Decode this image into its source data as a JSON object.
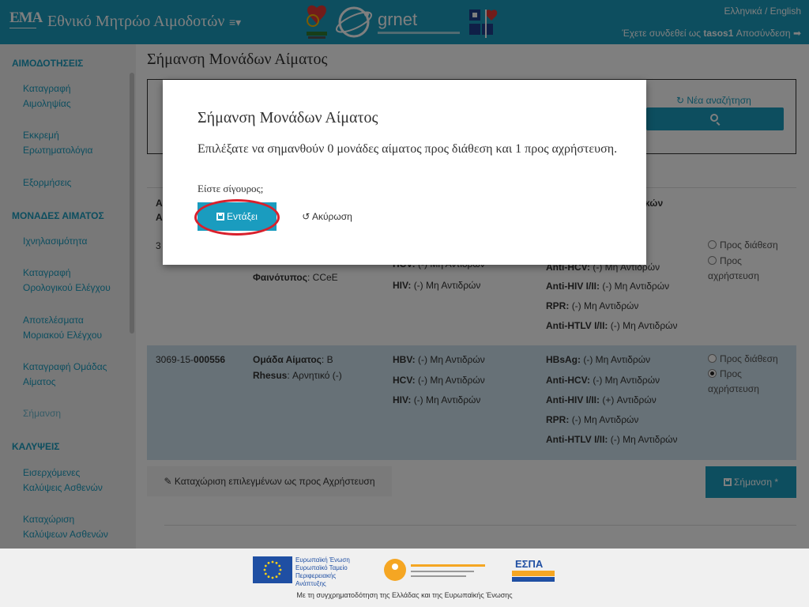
{
  "header": {
    "logo": "ΕΜΑ",
    "app_title": "Εθνικό Μητρώο Αιμοδοτών",
    "menu_toggle": "≡▾",
    "grnet": "grnet",
    "lang": "Ελληνικά / English",
    "login_prefix": "Έχετε συνδεθεί ως ",
    "username": "tasos1",
    "logout": "Αποσύνδεση"
  },
  "sidebar": {
    "sections": [
      {
        "title": "ΑΙΜΟΔΟΤΗΣΕΙΣ"
      },
      {
        "title": "ΜΟΝΑΔΕΣ ΑΙΜΑΤΟΣ"
      },
      {
        "title": "ΚΑΛΥΨΕΙΣ"
      }
    ],
    "items": [
      {
        "label": "Καταγραφή Αιμοληψίας"
      },
      {
        "label": "Εκκρεμή Ερωτηματολόγια"
      },
      {
        "label": "Εξορμήσεις"
      },
      {
        "label": "Ιχνηλασιμότητα"
      },
      {
        "label": "Καταγραφή Ορολογικού Ελέγχου"
      },
      {
        "label": "Αποτελέσματα Μοριακού Ελέγχου"
      },
      {
        "label": "Καταγραφή Ομάδας Αίματος"
      },
      {
        "label": "Σήμανση"
      },
      {
        "label": "Εισερχόμενες Καλύψεις Ασθενών"
      },
      {
        "label": "Καταχώριση Καλύψεων Ασθενών"
      }
    ]
  },
  "main": {
    "page_title": "Σήμανση Μονάδων Αίματος",
    "new_search": "Νέα αναζήτηση",
    "table_header": {
      "col1_a": "Α",
      "col1_b": "Α",
      "col4": "νικών"
    },
    "rows": [
      {
        "id": "3",
        "phenotype_label": "Φαινότυπος",
        "phenotype": "CCeE",
        "hcv": "(-) Μη Αντιδρών",
        "hiv": "(-) Μη Αντιδρών",
        "anti_hcv": "(-) Μη Αντιδρών",
        "anti_hiv": "(-) Μη Αντιδρών",
        "rpr": "(-) Μη Αντιδρών",
        "anti_htlv": "(-) Μη Αντιδρών",
        "opt_available": "Προς διάθεση",
        "opt_discard": "Προς αχρήστευση"
      },
      {
        "id_prefix": "3069-15-",
        "id_suffix": "000556",
        "blood_group_label": "Ομάδα Αίματος",
        "blood_group": "B",
        "rhesus_label": "Rhesus",
        "rhesus": "Αρνητικό (-)",
        "hbv": "(-) Μη Αντιδρών",
        "hcv": "(-) Μη Αντιδρών",
        "hiv": "(-) Μη Αντιδρών",
        "hbsag": "(-) Μη Αντιδρών",
        "anti_hcv": "(-) Μη Αντιδρών",
        "anti_hiv": "(+) Αντιδρών",
        "rpr": "(-) Μη Αντιδρών",
        "anti_htlv": "(-) Μη Αντιδρών",
        "opt_available": "Προς διάθεση",
        "opt_discard": "Προς αχρήστευση"
      }
    ],
    "labels": {
      "hbv": "HBV:",
      "hcv": "HCV:",
      "hiv": "HIV:",
      "hbsag": "HBsAg:",
      "anti_hcv": "Anti-HCV:",
      "anti_hiv": "Anti-HIV I/II:",
      "rpr": "RPR:",
      "anti_htlv": "Anti-HTLV I/II:"
    },
    "register_button": "Καταχώριση επιλεγμένων ως προς Αχρήστευση",
    "mark_button": "Σήμανση *"
  },
  "modal": {
    "title": "Σήμανση Μονάδων Αίματος",
    "body": "Επιλέξατε να σημανθούν 0 μονάδες αίματος προς διάθεση και 1 προς αχρήστευση.",
    "question": "Είστε σίγουρος;",
    "confirm": "Εντάξει",
    "cancel": "Ακύρωση"
  },
  "footer": {
    "eu_text": "Ευρωπαϊκή Ένωση Ευρωπαϊκό Ταμείο Περιφερειακής Ανάπτυξης",
    "digital": "ψηφιακή επιχείρηση",
    "espa": "ΕΣΠΑ",
    "note": "Με τη συγχρηματοδότηση της Ελλάδας και της Ευρωπαϊκής Ένωσης"
  },
  "colors": {
    "primary": "#1a9cbf",
    "highlight_row": "#cfe3ee",
    "annotation": "#d9202c"
  }
}
